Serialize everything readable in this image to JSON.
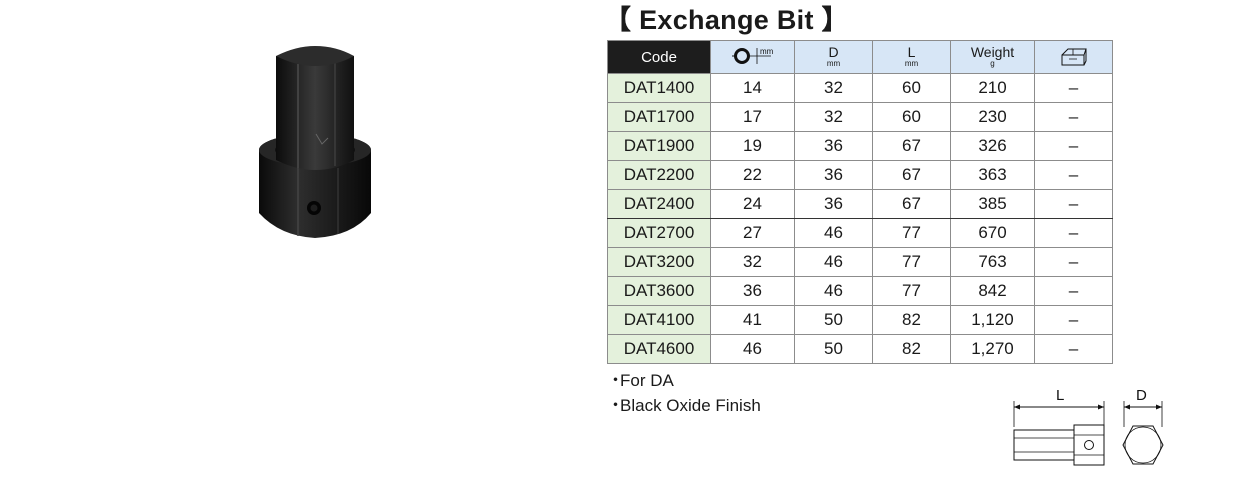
{
  "title": "【 Exchange Bit 】",
  "table": {
    "headers": {
      "code": "Code",
      "hex_unit": "mm",
      "d": "D",
      "d_unit": "mm",
      "l": "L",
      "l_unit": "mm",
      "weight": "Weight",
      "weight_unit": "g"
    },
    "rows": [
      {
        "code": "DAT1400",
        "hex": "14",
        "d": "32",
        "l": "60",
        "weight": "210",
        "extra": "–"
      },
      {
        "code": "DAT1700",
        "hex": "17",
        "d": "32",
        "l": "60",
        "weight": "230",
        "extra": "–"
      },
      {
        "code": "DAT1900",
        "hex": "19",
        "d": "36",
        "l": "67",
        "weight": "326",
        "extra": "–"
      },
      {
        "code": "DAT2200",
        "hex": "22",
        "d": "36",
        "l": "67",
        "weight": "363",
        "extra": "–"
      },
      {
        "code": "DAT2400",
        "hex": "24",
        "d": "36",
        "l": "67",
        "weight": "385",
        "extra": "–"
      },
      {
        "code": "DAT2700",
        "hex": "27",
        "d": "46",
        "l": "77",
        "weight": "670",
        "extra": "–"
      },
      {
        "code": "DAT3200",
        "hex": "32",
        "d": "46",
        "l": "77",
        "weight": "763",
        "extra": "–"
      },
      {
        "code": "DAT3600",
        "hex": "36",
        "d": "46",
        "l": "77",
        "weight": "842",
        "extra": "–"
      },
      {
        "code": "DAT4100",
        "hex": "41",
        "d": "50",
        "l": "82",
        "weight": "1,120",
        "extra": "–"
      },
      {
        "code": "DAT4600",
        "hex": "46",
        "d": "50",
        "l": "82",
        "weight": "1,270",
        "extra": "–"
      }
    ]
  },
  "notes": [
    {
      "bullet": "・",
      "text": "For DA"
    },
    {
      "bullet": "・",
      "text": "Black Oxide Finish"
    }
  ],
  "diagram": {
    "label_l": "L",
    "label_d": "D"
  },
  "colors": {
    "header_dark": "#1d1d1d",
    "header_light": "#d7e6f6",
    "code_cell": "#e4f1dc"
  }
}
